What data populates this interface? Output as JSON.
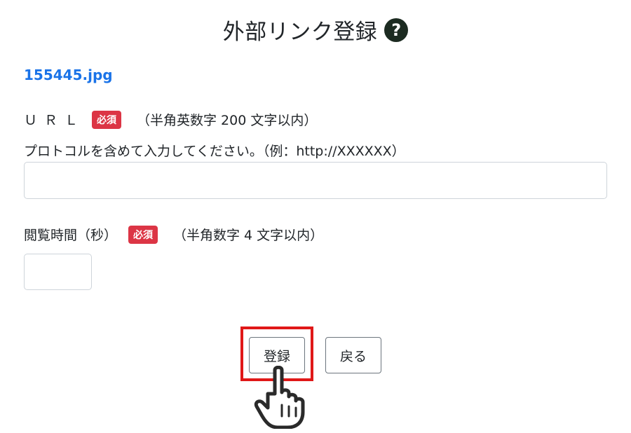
{
  "header": {
    "title": "外部リンク登録",
    "help_icon": "?"
  },
  "file": {
    "name": "155445.jpg"
  },
  "url_field": {
    "label": "ＵＲＬ",
    "required_badge": "必須",
    "constraint": "（半角英数字 200 文字以内）",
    "hint": "プロトコルを含めて入力してください。（例：http://XXXXXX）",
    "value": "",
    "placeholder": ""
  },
  "time_field": {
    "label": "閲覧時間（秒）",
    "required_badge": "必須",
    "constraint": "（半角数字 4 文字以内）",
    "value": "",
    "placeholder": ""
  },
  "actions": {
    "register_label": "登録",
    "back_label": "戻る"
  },
  "colors": {
    "badge": "#dc3545",
    "link": "#1a73e8",
    "highlight": "#e01818",
    "help_icon_bg": "#1c2b21"
  },
  "icons": {
    "help": "question-circle-icon",
    "pointer": "hand-pointer-icon"
  }
}
